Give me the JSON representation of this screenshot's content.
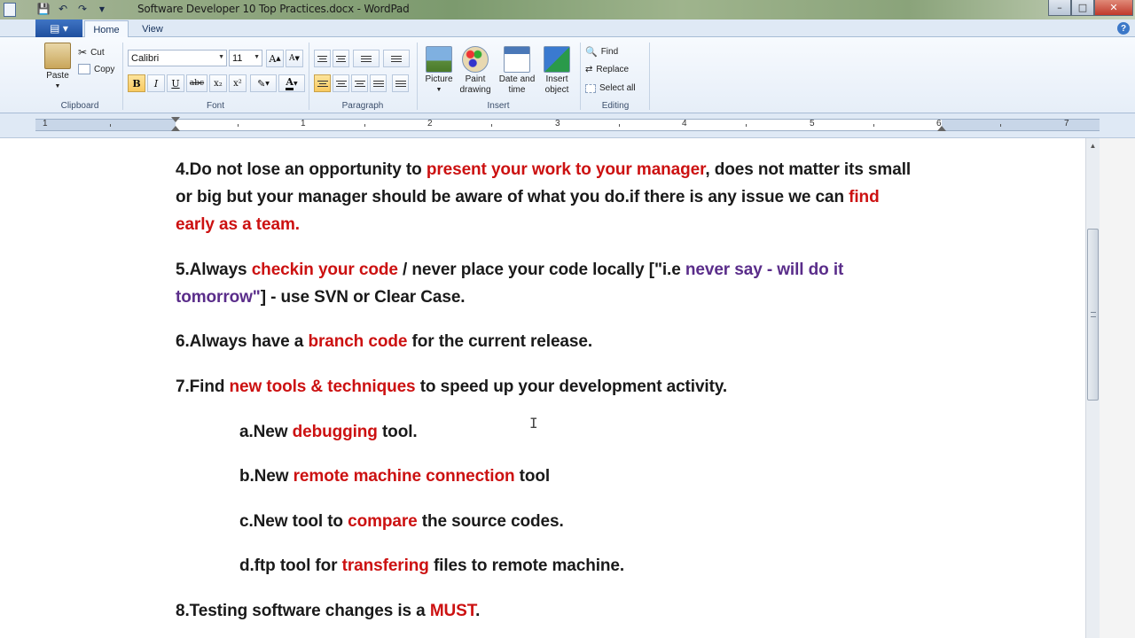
{
  "window": {
    "title": "Software Developer 10 Top Practices.docx - WordPad",
    "controls": {
      "minimize": "–",
      "maximize": "□",
      "close": "✕"
    }
  },
  "quick_access": [
    "save-icon",
    "undo-icon",
    "redo-icon",
    "dropdown-icon"
  ],
  "ribbon": {
    "tabs": {
      "file": "▤ ▾",
      "home": "Home",
      "view": "View"
    },
    "help": "?",
    "clipboard": {
      "label": "Clipboard",
      "paste": "Paste",
      "cut": "Cut",
      "copy": "Copy"
    },
    "font": {
      "label": "Font",
      "family": "Calibri",
      "size": "11",
      "grow": "A",
      "shrink": "A",
      "bold": "B",
      "italic": "I",
      "underline": "U",
      "strike": "abc",
      "subscript": "x₂",
      "superscript": "x²",
      "highlight": "✎",
      "color": "A"
    },
    "paragraph": {
      "label": "Paragraph"
    },
    "insert": {
      "label": "Insert",
      "picture": "Picture",
      "paint": "Paint drawing",
      "datetime": "Date and time",
      "object": "Insert object"
    },
    "editing": {
      "label": "Editing",
      "find": "Find",
      "replace": "Replace",
      "select_all": "Select all"
    }
  },
  "ruler": {
    "numbers": [
      "1",
      "1",
      "2",
      "3",
      "4",
      "5",
      "6",
      "7"
    ]
  },
  "document": {
    "p4": {
      "a": "4.Do not lose an opportunity to ",
      "b": "present your work to your manager",
      "c": ", does not matter its small",
      "d": "or big but your manager should be aware of what you do.if there is any issue we can ",
      "e": "find",
      "f": "early as a team."
    },
    "p5": {
      "a": "5.Always ",
      "b": "checkin your code",
      "c": " / never place your code locally [\"i.e ",
      "d": "never say - will do it",
      "e": "tomorrow\"",
      "f": "] - use SVN or Clear Case."
    },
    "p6": {
      "a": "6.Always have a ",
      "b": "branch code",
      "c": " for the current release."
    },
    "p7": {
      "a": "7.Find ",
      "b": "new tools & techniques",
      "c": " to speed up your development activity."
    },
    "p7a": {
      "a": "a.New ",
      "b": "debugging",
      "c": " tool."
    },
    "p7b": {
      "a": "b.New ",
      "b": "remote machine connection",
      "c": " tool"
    },
    "p7c": {
      "a": "c.New tool to ",
      "b": "compare",
      "c": " the source codes."
    },
    "p7d": {
      "a": "d.ftp tool for ",
      "b": "transfering",
      "c": " files to remote machine."
    },
    "p8": {
      "a": "8.Testing software changes is a ",
      "b": "MUST",
      "c": "."
    }
  },
  "colors": {
    "accent_red": "#cc1111",
    "accent_purple": "#5a2d8a",
    "ribbon_blue": "#1f4f9e"
  }
}
